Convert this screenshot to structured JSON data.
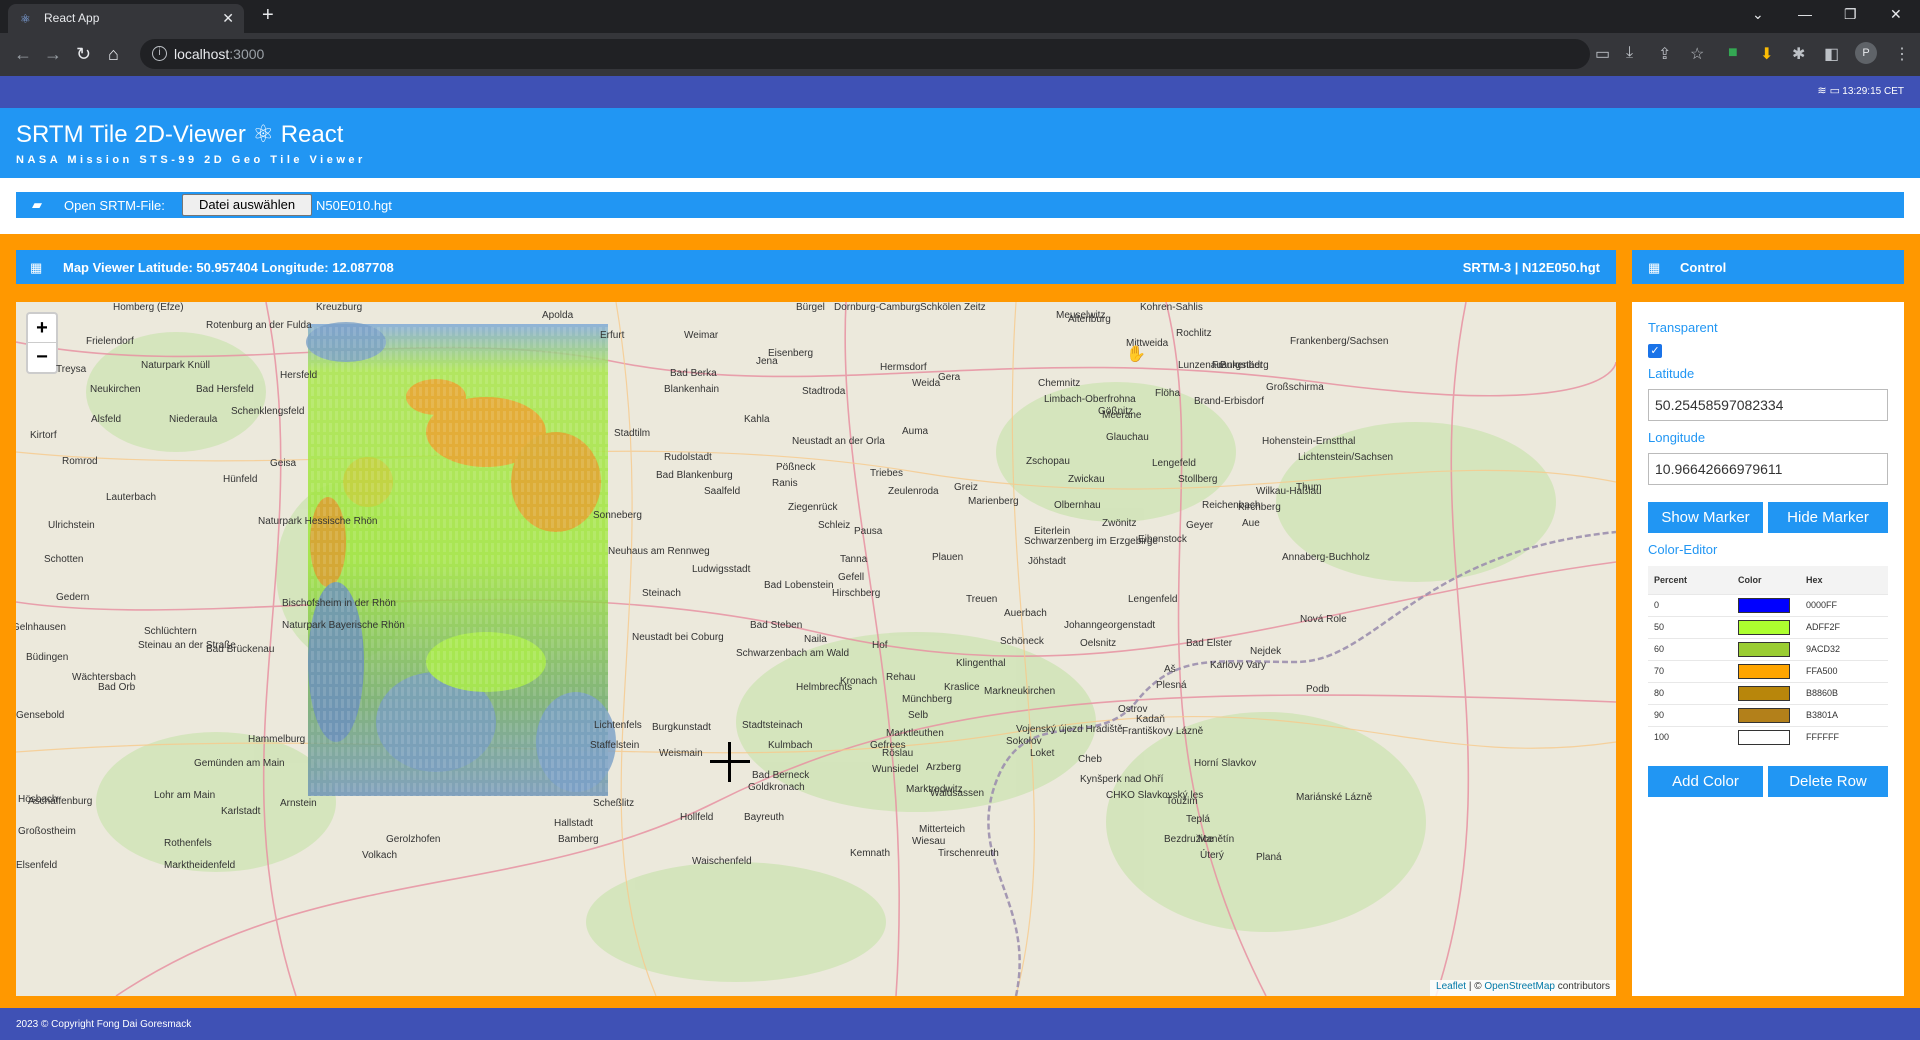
{
  "browser": {
    "tab_title": "React App",
    "url_host": "localhost",
    "url_port": ":3000"
  },
  "status": {
    "time": "13:29:15 CET"
  },
  "header": {
    "title": "SRTM Tile 2D-Viewer ⚛ React",
    "subtitle": "NASA Mission STS-99 2D Geo Tile Viewer"
  },
  "file": {
    "label": "Open SRTM-File:",
    "button": "Datei auswählen",
    "name": "N50E010.hgt"
  },
  "map": {
    "title": "Map Viewer Latitude: 50.957404 Longitude: 12.087708",
    "tile_info": "SRTM-3 | N12E050.hgt",
    "zoom_in": "+",
    "zoom_out": "−",
    "attribution_leaflet": "Leaflet",
    "attribution_sep": " | © ",
    "attribution_osm": "OpenStreetMap",
    "attribution_tail": " contributors",
    "places": [
      {
        "name": "Homberg (Efze)"
      },
      {
        "name": "Rotenburg an der Fulda"
      },
      {
        "name": "Frielendorf"
      },
      {
        "name": "Treysa"
      },
      {
        "name": "Naturpark Knüll"
      },
      {
        "name": "Neukirchen"
      },
      {
        "name": "Bad Hersfeld"
      },
      {
        "name": "Niederaula"
      },
      {
        "name": "Schenklengsfeld"
      },
      {
        "name": "Alsfeld"
      },
      {
        "name": "Kirtorf"
      },
      {
        "name": "Romrod"
      },
      {
        "name": "Hünfeld"
      },
      {
        "name": "Lauterbach"
      },
      {
        "name": "Ulrichstein"
      },
      {
        "name": "Naturpark Hessische Rhön"
      },
      {
        "name": "Schotten"
      },
      {
        "name": "Gedern"
      },
      {
        "name": "Schlüchtern"
      },
      {
        "name": "Büdingen"
      },
      {
        "name": "Bad Brückenau"
      },
      {
        "name": "Wächtersbach"
      },
      {
        "name": "Bad Orb"
      },
      {
        "name": "Hammelburg"
      },
      {
        "name": "Gemünden am Main"
      },
      {
        "name": "Lohr am Main"
      },
      {
        "name": "Karlstadt"
      },
      {
        "name": "Arnstein"
      },
      {
        "name": "Aschaffenburg"
      },
      {
        "name": "Rothenfels"
      },
      {
        "name": "Marktheidenfeld"
      },
      {
        "name": "Volkach"
      },
      {
        "name": "Gerolzhofen"
      },
      {
        "name": "Weimar"
      },
      {
        "name": "Apolda"
      },
      {
        "name": "Jena"
      },
      {
        "name": "Bad Berka"
      },
      {
        "name": "Blankenhain"
      },
      {
        "name": "Stadtroda"
      },
      {
        "name": "Kahla"
      },
      {
        "name": "Stadtilm"
      },
      {
        "name": "Rudolstadt"
      },
      {
        "name": "Bad Blankenburg"
      },
      {
        "name": "Saalfeld"
      },
      {
        "name": "Neustadt an der Orla"
      },
      {
        "name": "Pößneck"
      },
      {
        "name": "Ranis"
      },
      {
        "name": "Ziegenrück"
      },
      {
        "name": "Schleiz"
      },
      {
        "name": "Neuhaus am Rennweg"
      },
      {
        "name": "Ludwigsstadt"
      },
      {
        "name": "Steinach"
      },
      {
        "name": "Bad Lobenstein"
      },
      {
        "name": "Tanna"
      },
      {
        "name": "Gefell"
      },
      {
        "name": "Hirschberg"
      },
      {
        "name": "Bad Steben"
      },
      {
        "name": "Naila"
      },
      {
        "name": "Neustadt bei Coburg"
      },
      {
        "name": "Kronach"
      },
      {
        "name": "Schwarzenbach am Wald"
      },
      {
        "name": "Helmbrechts"
      },
      {
        "name": "Hof"
      },
      {
        "name": "Rehau"
      },
      {
        "name": "Münchberg"
      },
      {
        "name": "Selb"
      },
      {
        "name": "Marktleuthen"
      },
      {
        "name": "Lichtenfels"
      },
      {
        "name": "Burgkunstadt"
      },
      {
        "name": "Stadtsteinach"
      },
      {
        "name": "Kulmbach"
      },
      {
        "name": "Weismain"
      },
      {
        "name": "Staffelstein"
      },
      {
        "name": "Gefrees"
      },
      {
        "name": "Bad Berneck"
      },
      {
        "name": "Goldkronach"
      },
      {
        "name": "Wunsiedel"
      },
      {
        "name": "Röslau"
      },
      {
        "name": "Marktredwitz"
      },
      {
        "name": "Waldsassen"
      },
      {
        "name": "Arzberg"
      },
      {
        "name": "Hollfeld"
      },
      {
        "name": "Bayreuth"
      },
      {
        "name": "Mitterteich"
      },
      {
        "name": "Wiesau"
      },
      {
        "name": "Hallstadt"
      },
      {
        "name": "Bamberg"
      },
      {
        "name": "Scheßlitz"
      },
      {
        "name": "Waischenfeld"
      },
      {
        "name": "Kemnath"
      },
      {
        "name": "Tirschenreuth"
      },
      {
        "name": "Plauen"
      },
      {
        "name": "Greiz"
      },
      {
        "name": "Zeulenroda"
      },
      {
        "name": "Pausa"
      },
      {
        "name": "Triebes"
      },
      {
        "name": "Auma"
      },
      {
        "name": "Weida"
      },
      {
        "name": "Gera"
      },
      {
        "name": "Hermsdorf"
      },
      {
        "name": "Eisenberg"
      },
      {
        "name": "Bürgel"
      },
      {
        "name": "Dornburg-Camburg"
      },
      {
        "name": "Schkölen"
      },
      {
        "name": "Zeitz"
      },
      {
        "name": "Meuselwitz"
      },
      {
        "name": "Altenburg"
      },
      {
        "name": "Kohren-Sahlis"
      },
      {
        "name": "Rochlitz"
      },
      {
        "name": "Mittweida"
      },
      {
        "name": "Lunzenau"
      },
      {
        "name": "Burgstädt"
      },
      {
        "name": "Frankenberg/Sachsen"
      },
      {
        "name": "Großschirma"
      },
      {
        "name": "Brand-Erbisdorf"
      },
      {
        "name": "Flöha"
      },
      {
        "name": "Chemnitz"
      },
      {
        "name": "Limbach-Oberfrohna"
      },
      {
        "name": "Gößnitz"
      },
      {
        "name": "Meerane"
      },
      {
        "name": "Glauchau"
      },
      {
        "name": "Hohenstein-Ernstthal"
      },
      {
        "name": "Lichtenstein/Sachsen"
      },
      {
        "name": "Zschopau"
      },
      {
        "name": "Lengefeld"
      },
      {
        "name": "Zwickau"
      },
      {
        "name": "Stollberg"
      },
      {
        "name": "Wilkau-Haßlau"
      },
      {
        "name": "Thum"
      },
      {
        "name": "Marienberg"
      },
      {
        "name": "Olbernhau"
      },
      {
        "name": "Reichenbach"
      },
      {
        "name": "Kirchberg"
      },
      {
        "name": "Zwönitz"
      },
      {
        "name": "Geyer"
      },
      {
        "name": "Aue"
      },
      {
        "name": "Eibenstock"
      },
      {
        "name": "Annaberg-Buchholz"
      },
      {
        "name": "Eiterlein"
      },
      {
        "name": "Schwarzenberg im Erzgebirge"
      },
      {
        "name": "Jöhstadt"
      },
      {
        "name": "Lengenfeld"
      },
      {
        "name": "Treuen"
      },
      {
        "name": "Auerbach"
      },
      {
        "name": "Johanngeorgenstadt"
      },
      {
        "name": "Oelsnitz"
      },
      {
        "name": "Schöneck"
      },
      {
        "name": "Klingenthal"
      },
      {
        "name": "Kraslice"
      },
      {
        "name": "Markneukirchen"
      },
      {
        "name": "Bad Elster"
      },
      {
        "name": "Aš"
      },
      {
        "name": "Plesná"
      },
      {
        "name": "Nejdek"
      },
      {
        "name": "Nová Role"
      },
      {
        "name": "Karlovy Vary"
      },
      {
        "name": "Ostrov"
      },
      {
        "name": "Kadaň"
      },
      {
        "name": "Vojenský újezd Hradiště"
      },
      {
        "name": "Sokolov"
      },
      {
        "name": "Loket"
      },
      {
        "name": "Františkovy Lázně"
      },
      {
        "name": "Cheb"
      },
      {
        "name": "Kynšperk nad Ohří"
      },
      {
        "name": "Horní Slavkov"
      },
      {
        "name": "CHKO Slavkovský les"
      },
      {
        "name": "Toužim"
      },
      {
        "name": "Mariánské Lázně"
      },
      {
        "name": "Teplá"
      },
      {
        "name": "Manětín"
      },
      {
        "name": "Bezdružice"
      },
      {
        "name": "Úterý"
      },
      {
        "name": "Planá"
      },
      {
        "name": "Erfurt"
      },
      {
        "name": "Hersfeld"
      },
      {
        "name": "Bischofsheim in der Rhön"
      },
      {
        "name": "Steinau an der Straße"
      },
      {
        "name": "Gelnhausen"
      },
      {
        "name": "Kreuzburg"
      },
      {
        "name": "Geisa"
      },
      {
        "name": "Sonneberg"
      },
      {
        "name": "Podb"
      },
      {
        "name": "Elsenfeld"
      },
      {
        "name": "Großostheim"
      },
      {
        "name": "Hösbach"
      },
      {
        "name": "Gensebold"
      },
      {
        "name": "Naturpark Bayerische Rhön"
      },
      {
        "name": "Frankenberg"
      }
    ]
  },
  "control": {
    "title": "Control",
    "transparent_label": "Transparent",
    "latitude_label": "Latitude",
    "latitude_value": "50.25458597082334",
    "longitude_label": "Longitude",
    "longitude_value": "10.96642666979611",
    "show_marker": "Show Marker",
    "hide_marker": "Hide Marker",
    "color_editor_label": "Color-Editor",
    "table_headers": {
      "percent": "Percent",
      "color": "Color",
      "hex": "Hex"
    },
    "rows": [
      {
        "percent": "0",
        "hex": "0000FF",
        "color": "#0000FF"
      },
      {
        "percent": "50",
        "hex": "ADFF2F",
        "color": "#ADFF2F"
      },
      {
        "percent": "60",
        "hex": "9ACD32",
        "color": "#9ACD32"
      },
      {
        "percent": "70",
        "hex": "FFA500",
        "color": "#FFA500"
      },
      {
        "percent": "80",
        "hex": "B8860B",
        "color": "#B8860B"
      },
      {
        "percent": "90",
        "hex": "B3801A",
        "color": "#B3801A"
      },
      {
        "percent": "100",
        "hex": "FFFFFF",
        "color": "#FFFFFF"
      }
    ],
    "add_color": "Add Color",
    "delete_row": "Delete Row"
  },
  "footer": {
    "text": "2023 © Copyright Fong Dai Goresmack"
  },
  "colors": {
    "primary": "#2196f3",
    "indigo": "#3f51b5",
    "orange": "#ff9800"
  }
}
